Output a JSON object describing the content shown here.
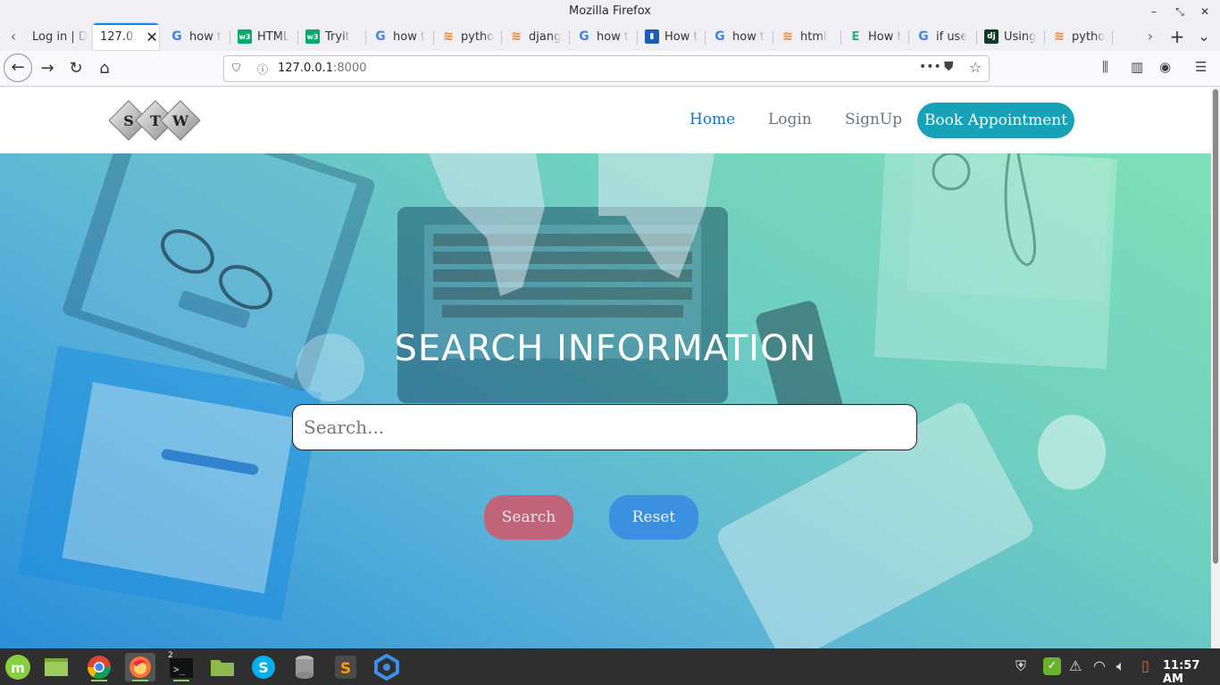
{
  "window": {
    "title": "Mozilla Firefox"
  },
  "tabs": [
    {
      "label": "Log in | D",
      "icon": "dark-logo-icon"
    },
    {
      "label": "127.0.",
      "icon": "none",
      "active": true
    },
    {
      "label": "how t",
      "icon": "google-icon"
    },
    {
      "label": "HTML",
      "icon": "w3schools-icon"
    },
    {
      "label": "Tryit",
      "icon": "w3schools-icon"
    },
    {
      "label": "how t",
      "icon": "google-icon"
    },
    {
      "label": "pytho",
      "icon": "stackoverflow-icon"
    },
    {
      "label": "djang",
      "icon": "stackoverflow-icon"
    },
    {
      "label": "how t",
      "icon": "google-icon"
    },
    {
      "label": "How t",
      "icon": "bookmark-icon"
    },
    {
      "label": "how t",
      "icon": "google-icon"
    },
    {
      "label": "html",
      "icon": "stackoverflow-icon"
    },
    {
      "label": "How t",
      "icon": "educba-icon"
    },
    {
      "label": "if use",
      "icon": "google-icon"
    },
    {
      "label": "Using",
      "icon": "django-icon"
    },
    {
      "label": "pytho",
      "icon": "stackoverflow-icon"
    }
  ],
  "address": {
    "host": "127.0.0.1",
    "port": ":8000"
  },
  "site": {
    "logo_letters": [
      "S",
      "T",
      "W"
    ],
    "nav": {
      "home": "Home",
      "login": "Login",
      "signup": "SignUp",
      "book": "Book Appointment"
    },
    "hero_title": "SEARCH INFORMATION",
    "search_placeholder": "Search...",
    "search_button": "Search",
    "reset_button": "Reset"
  },
  "taskbar": {
    "apps": [
      "mint-menu-icon",
      "files-icon",
      "chrome-icon",
      "firefox-icon",
      "terminal-icon",
      "folder-icon",
      "skype-icon",
      "database-icon",
      "sublime-icon",
      "app-icon"
    ],
    "terminal_badge": "2",
    "clock": "11:57 AM"
  },
  "colors": {
    "accent": "#17a2b8",
    "link": "#1e73be",
    "search_btn": "#c0647a",
    "reset_btn": "#3b90e0"
  }
}
